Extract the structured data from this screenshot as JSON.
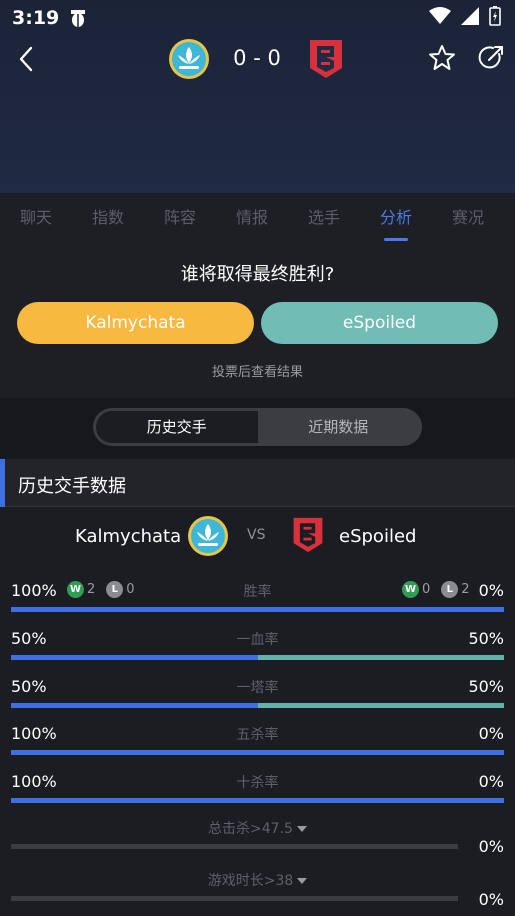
{
  "status_bar": {
    "time": "3:19",
    "app_icon": "bug-icon"
  },
  "match": {
    "home_team": "Kalmychata",
    "away_team": "eSpoiled",
    "score": "0 - 0"
  },
  "tabs": [
    {
      "label": "聊天",
      "active": false
    },
    {
      "label": "指数",
      "active": false
    },
    {
      "label": "阵容",
      "active": false
    },
    {
      "label": "情报",
      "active": false
    },
    {
      "label": "选手",
      "active": false
    },
    {
      "label": "分析",
      "active": true
    },
    {
      "label": "赛况",
      "active": false
    }
  ],
  "vote": {
    "question": "谁将取得最终胜利?",
    "home_label": "Kalmychata",
    "away_label": "eSpoiled",
    "note": "投票后查看结果"
  },
  "segment": {
    "history": "历史交手",
    "recent": "近期数据"
  },
  "section_title": "历史交手数据",
  "versus_text": "VS",
  "stats": [
    {
      "label": "胜率",
      "left": "100%",
      "right": "0%",
      "left_share": 100,
      "home_w": "2",
      "home_l": "0",
      "away_w": "0",
      "away_l": "2"
    },
    {
      "label": "一血率",
      "left": "50%",
      "right": "50%",
      "left_share": 50
    },
    {
      "label": "一塔率",
      "left": "50%",
      "right": "50%",
      "left_share": 50
    },
    {
      "label": "五杀率",
      "left": "100%",
      "right": "0%",
      "left_share": 100
    },
    {
      "label": "十杀率",
      "left": "100%",
      "right": "0%",
      "left_share": 100
    }
  ],
  "threshold_stats": [
    {
      "label": "总击杀>47.5",
      "value": "0%"
    },
    {
      "label": "游戏时长>38",
      "value": "0%"
    }
  ],
  "badges": {
    "win": "W",
    "loss": "L"
  },
  "colors": {
    "accent_blue": "#3f70e3",
    "vote_home": "#f7b940",
    "vote_away": "#6fbdb5",
    "bar_teal": "#62b0a8",
    "win_green": "#2f9e53"
  }
}
